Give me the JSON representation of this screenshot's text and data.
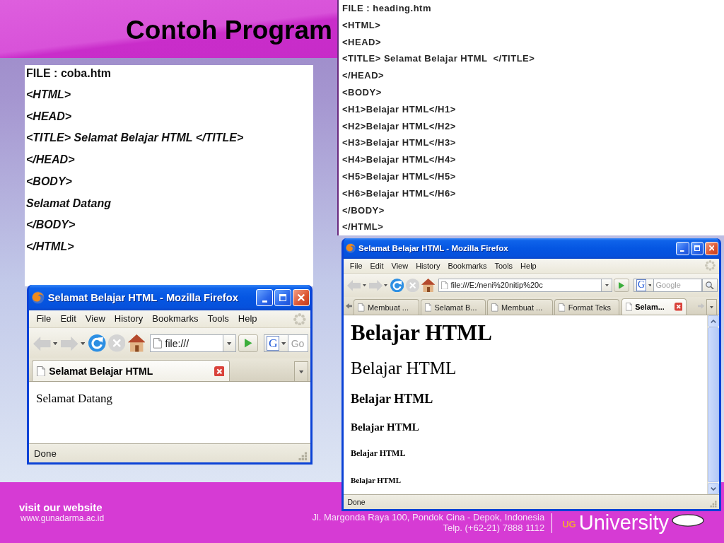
{
  "slide": {
    "title": "Contoh Program"
  },
  "code_panels": [
    {
      "kind": "italic",
      "file_label": "FILE : coba.htm",
      "lines": [
        "<HTML>",
        "<HEAD>",
        "<TITLE> Selamat Belajar HTML </TITLE>",
        "</HEAD>",
        "<BODY>",
        "Selamat Datang",
        "</BODY>",
        "</HTML>"
      ]
    },
    {
      "kind": "plain",
      "file_label": "FILE : heading.htm",
      "lines": [
        "<HTML>",
        "<HEAD>",
        "<TITLE> Selamat Belajar HTML  </TITLE>",
        "</HEAD>",
        "<BODY>",
        "<H1>Belajar HTML</H1>",
        "<H2>Belajar HTML</H2>",
        "<H3>Belajar HTML</H3>",
        "<H4>Belajar HTML</H4>",
        "<H5>Belajar HTML</H5>",
        "<H6>Belajar HTML</H6>",
        "</BODY>",
        "</HTML>"
      ]
    }
  ],
  "browser_windows": [
    {
      "title": "Selamat Belajar HTML - Mozilla Firefox",
      "menu": [
        "File",
        "Edit",
        "View",
        "History",
        "Bookmarks",
        "Tools",
        "Help"
      ],
      "toolbar_buttons": [
        {
          "kind": "back",
          "disabled": true
        },
        {
          "kind": "forward",
          "disabled": true
        },
        {
          "kind": "reload",
          "disabled": false
        },
        {
          "kind": "stop",
          "disabled": true
        },
        {
          "kind": "home",
          "disabled": false
        }
      ],
      "address": "file:///",
      "search": {
        "engine": "G",
        "placeholder": "Go",
        "search_button": false
      },
      "tab_scroll_arrows": false,
      "tabs": [
        {
          "label": "Selamat Belajar HTML",
          "selected": true
        }
      ],
      "content": [
        {
          "kind": "p",
          "text": "Selamat Datang"
        }
      ],
      "vertical_scrollbar": false,
      "status": "Done"
    },
    {
      "title": "Selamat Belajar HTML - Mozilla Firefox",
      "menu": [
        "File",
        "Edit",
        "View",
        "History",
        "Bookmarks",
        "Tools",
        "Help"
      ],
      "toolbar_buttons": [
        {
          "kind": "back",
          "disabled": true
        },
        {
          "kind": "forward",
          "disabled": true
        },
        {
          "kind": "reload",
          "disabled": false
        },
        {
          "kind": "stop",
          "disabled": true
        },
        {
          "kind": "home",
          "disabled": false
        }
      ],
      "address": "file:///E:/neni%20nitip%20c",
      "search": {
        "engine": "G",
        "placeholder": "Google",
        "search_button": true
      },
      "tab_scroll_arrows": true,
      "tabs": [
        {
          "label": "Membuat ...",
          "selected": false
        },
        {
          "label": "Selamat B...",
          "selected": false
        },
        {
          "label": "Membuat ...",
          "selected": false
        },
        {
          "label": "Format Teks",
          "selected": false
        },
        {
          "label": "Selam...",
          "selected": true
        }
      ],
      "content": [
        {
          "kind": "h1",
          "text": "Belajar HTML"
        },
        {
          "kind": "h2",
          "text": "Belajar HTML"
        },
        {
          "kind": "h3",
          "text": "Belajar HTML"
        },
        {
          "kind": "h4",
          "text": "Belajar HTML"
        },
        {
          "kind": "h5",
          "text": "Belajar HTML"
        },
        {
          "kind": "h6",
          "text": "Belajar HTML"
        }
      ],
      "vertical_scrollbar": true,
      "status": "Done"
    }
  ],
  "footer": {
    "caption": "visit our website",
    "website": "www.gunadarma.ac.id",
    "address": [
      "Jl. Margonda Raya 100, Pondok Cina - Depok, Indonesia",
      "Telp. (+62-21) 7888 1112"
    ],
    "brand": {
      "mark": "UG",
      "name": "University"
    }
  }
}
